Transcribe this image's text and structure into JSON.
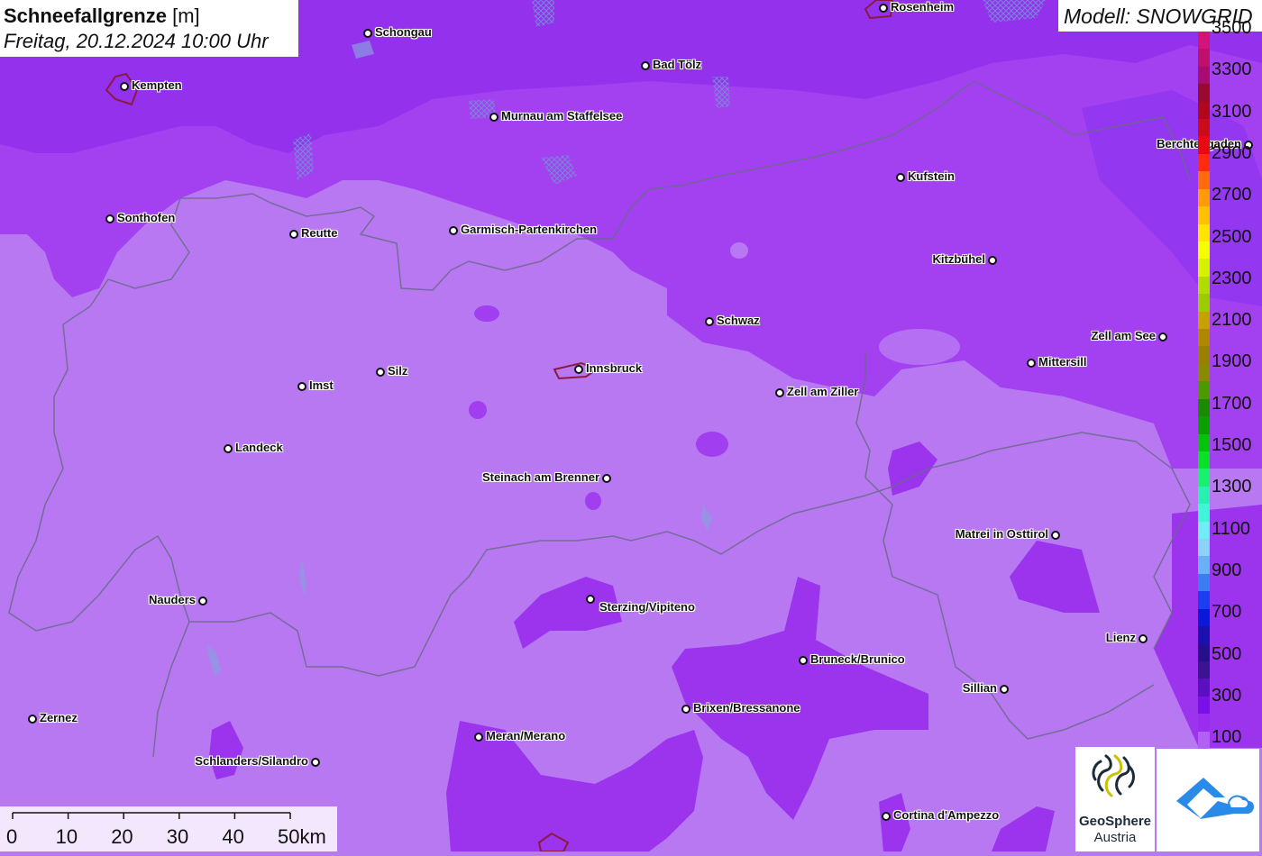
{
  "title": {
    "name": "Schneefallgrenze",
    "unit": "[m]",
    "datetime": "Freitag, 20.12.2024 10:00 Uhr"
  },
  "model": {
    "label": "Modell: SNOWGRID"
  },
  "cities": [
    {
      "name": "Rosenheim"
    },
    {
      "name": "Schongau"
    },
    {
      "name": "Bad Tölz"
    },
    {
      "name": "Kempten"
    },
    {
      "name": "Murnau am Staffelsee"
    },
    {
      "name": "Berchtesgaden"
    },
    {
      "name": "Kufstein"
    },
    {
      "name": "Sonthofen"
    },
    {
      "name": "Reutte"
    },
    {
      "name": "Garmisch-Partenkirchen"
    },
    {
      "name": "Kitzbühel"
    },
    {
      "name": "Schwaz"
    },
    {
      "name": "Zell am See"
    },
    {
      "name": "Mittersill"
    },
    {
      "name": "Innsbruck"
    },
    {
      "name": "Silz"
    },
    {
      "name": "Imst"
    },
    {
      "name": "Zell am Ziller"
    },
    {
      "name": "Landeck"
    },
    {
      "name": "Steinach am Brenner"
    },
    {
      "name": "Matrei in Osttirol"
    },
    {
      "name": "Nauders"
    },
    {
      "name": "Sterzing/Vipiteno"
    },
    {
      "name": "Lienz"
    },
    {
      "name": "Bruneck/Brunico"
    },
    {
      "name": "Sillian"
    },
    {
      "name": "Brixen/Bressanone"
    },
    {
      "name": "Zernez"
    },
    {
      "name": "Meran/Merano"
    },
    {
      "name": "Schlanders/Silandro"
    },
    {
      "name": "Cortina d'Ampezzo"
    }
  ],
  "legend": {
    "unit": "m",
    "labels": [
      "3500",
      "3300",
      "3100",
      "2900",
      "2700",
      "2500",
      "2300",
      "2100",
      "1900",
      "1700",
      "1500",
      "1300",
      "1100",
      "900",
      "700",
      "500",
      "300",
      "100"
    ],
    "colors": [
      "#d21478",
      "#c0106c",
      "#a80c70",
      "#980a2e",
      "#b0081a",
      "#cc0a18",
      "#e80a12",
      "#ff2a10",
      "#ff6a0a",
      "#ff9a08",
      "#ffc000",
      "#ffe400",
      "#f4ff00",
      "#d6f200",
      "#b0dc00",
      "#9acc00",
      "#c8a000",
      "#b08800",
      "#988000",
      "#8a8a00",
      "#4c9a00",
      "#1a8a00",
      "#0aa000",
      "#06c20a",
      "#0ae028",
      "#18f070",
      "#28f0b0",
      "#40f4d8",
      "#70ecf4",
      "#8cd2f8",
      "#6ab0f6",
      "#3a7cf2",
      "#1a3ef0",
      "#0a18d8",
      "#1a10b0",
      "#24108a",
      "#3a1490",
      "#5a10c0",
      "#7a10e8",
      "#9a2cf0",
      "#b060f4"
    ]
  },
  "scale_bar": {
    "ticks": [
      "0",
      "10",
      "20",
      "30",
      "40",
      "50km"
    ]
  },
  "branding": {
    "org_name_1": "GeoSphere",
    "org_name_2": "Austria",
    "logo2_icon": "cloud-mountain-icon"
  }
}
